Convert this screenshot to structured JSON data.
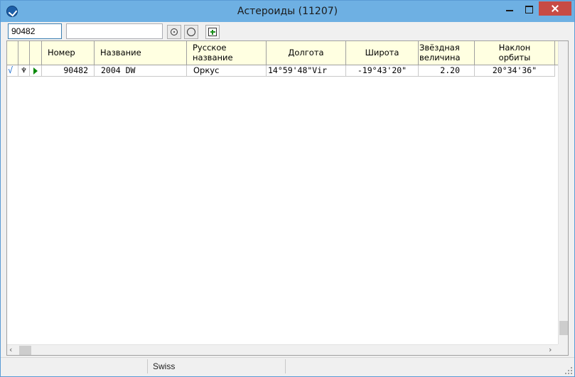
{
  "window": {
    "title": "Астероиды (11207)"
  },
  "toolbar": {
    "number_value": "90482",
    "name_value": ""
  },
  "table": {
    "columns": [
      {
        "key": "check",
        "label": ""
      },
      {
        "key": "symbol",
        "label": ""
      },
      {
        "key": "arrow",
        "label": ""
      },
      {
        "key": "number",
        "label": "Номер"
      },
      {
        "key": "name",
        "label": "Название"
      },
      {
        "key": "russian_name",
        "label": "Русское название"
      },
      {
        "key": "longitude",
        "label": "Долгота"
      },
      {
        "key": "latitude",
        "label": "Широта"
      },
      {
        "key": "magnitude",
        "label": "Звёздная величина"
      },
      {
        "key": "inclination",
        "label": "Наклон орбиты"
      }
    ],
    "rows": [
      {
        "check": "√",
        "symbol": "♆",
        "arrow": "play-icon",
        "number": "90482",
        "name": "2004 DW",
        "russian_name": "Оркус",
        "longitude": "14°59'48\"Vir",
        "latitude": "-19°43'20\"",
        "magnitude": "2.20",
        "inclination": "20°34'36\""
      }
    ]
  },
  "status": {
    "panel2": "Swiss"
  },
  "colors": {
    "title_bar": "#6eb0e3",
    "close_button": "#c74b45",
    "header_bg": "#ffffe1",
    "check_mark": "#1d6fd1",
    "arrow": "#0a8a0a"
  }
}
